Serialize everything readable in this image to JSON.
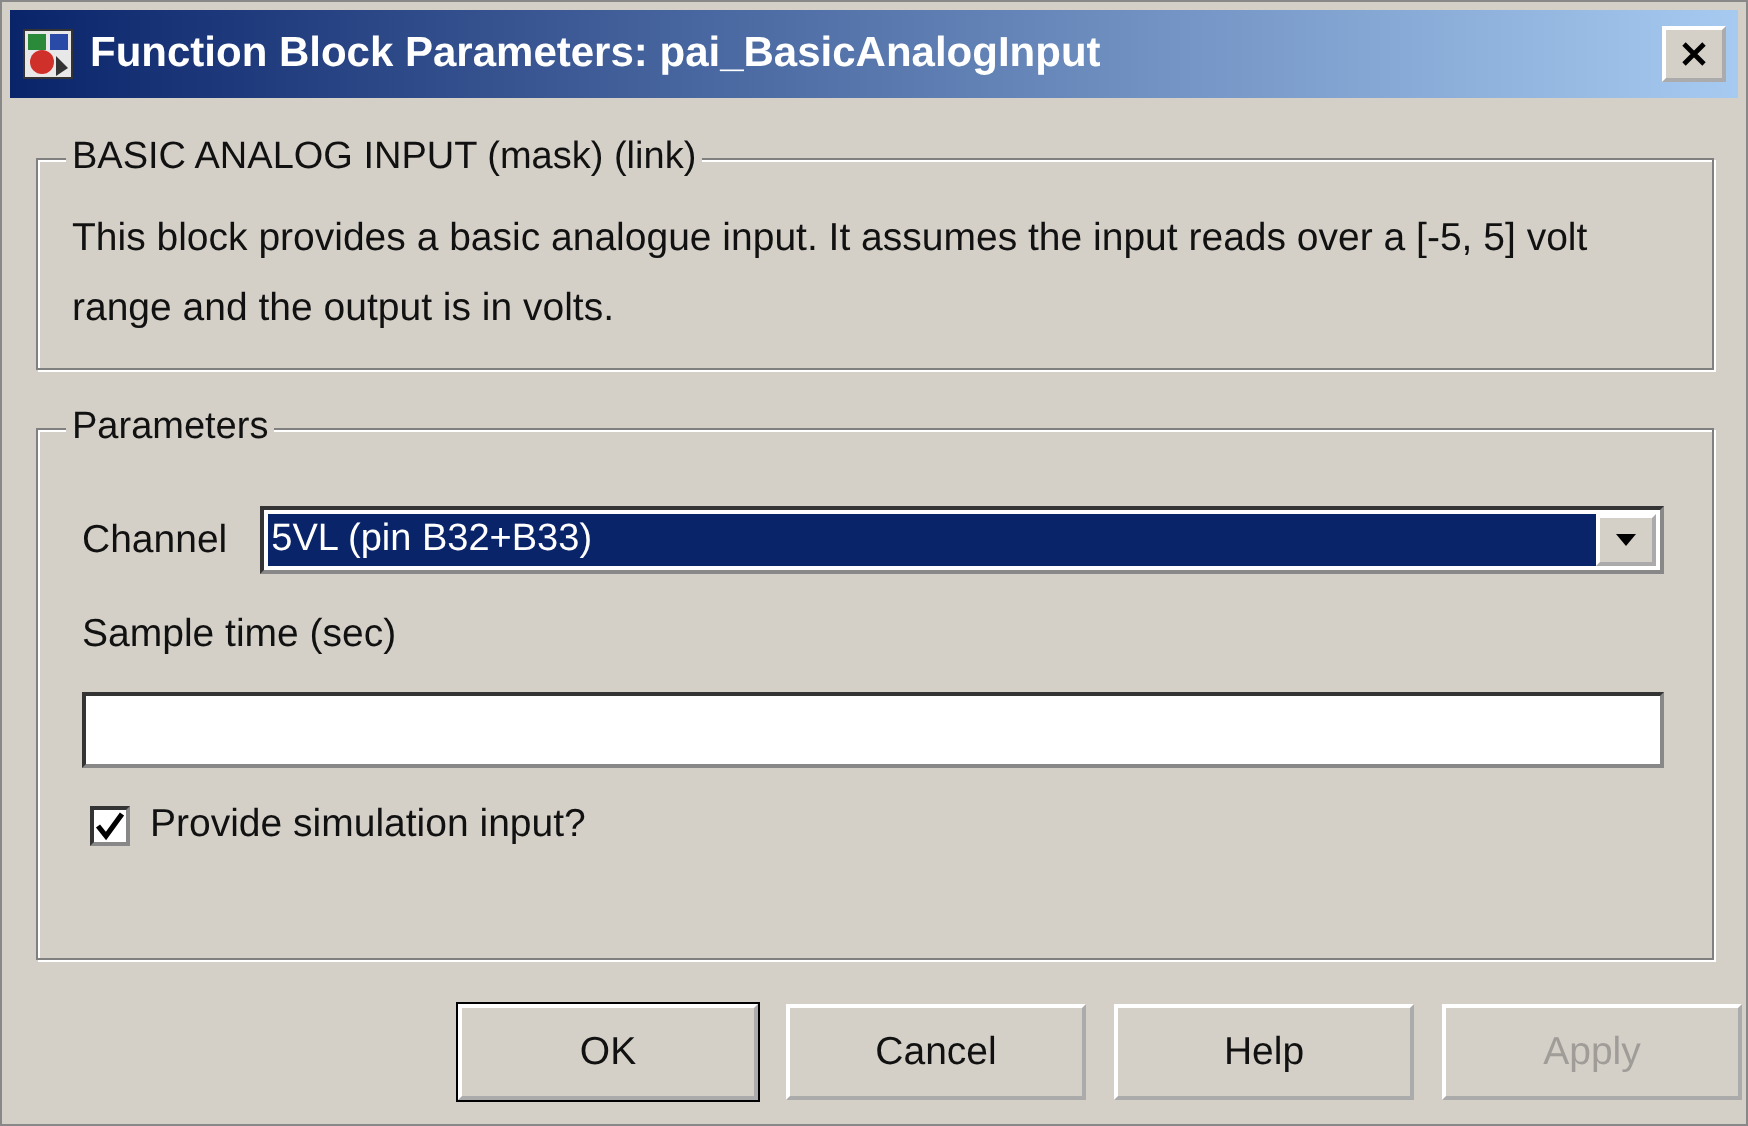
{
  "window": {
    "title": "Function Block Parameters: pai_BasicAnalogInput"
  },
  "description_group": {
    "legend": "BASIC ANALOG INPUT (mask) (link)",
    "text": "This block provides a basic analogue input. It assumes the input reads over a [-5, 5] volt range and the output is in volts."
  },
  "parameters_group": {
    "legend": "Parameters",
    "channel": {
      "label": "Channel",
      "value": "5VL (pin B32+B33)",
      "highlighted": true
    },
    "sample_time": {
      "label": "Sample time (sec)"
    },
    "simulation_input": {
      "label": "Provide simulation input?",
      "checked": true
    }
  },
  "buttons": [
    {
      "label": "OK",
      "default": true,
      "disabled": false
    },
    {
      "label": "Cancel",
      "default": false,
      "disabled": false
    },
    {
      "label": "Help",
      "default": false,
      "disabled": false
    },
    {
      "label": "Apply",
      "default": false,
      "disabled": true
    }
  ]
}
